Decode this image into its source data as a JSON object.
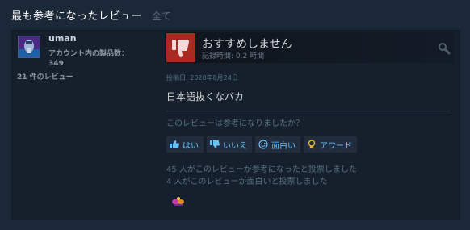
{
  "section": {
    "title": "最も参考になったレビュー",
    "see_all": "全て"
  },
  "author": {
    "name": "uman",
    "products_label": "アカウント内の製品数：",
    "products_count": "349",
    "reviews_count": "21 件のレビュー"
  },
  "review": {
    "verdict": "おすすめしません",
    "playtime": "記録時間: 0.2 時間",
    "posted": "投稿日: 2020年8月24日",
    "body": "日本語抜くなバカ"
  },
  "feedback": {
    "question": "このレビューは参考になりましたか？",
    "buttons": {
      "yes": "はい",
      "no": "いいえ",
      "funny": "面白い",
      "award": "アワード"
    },
    "helpful_stat": "45 人がこのレビューが参考になったと投票しました",
    "funny_stat": "4 人がこのレビューが面白いと投票しました"
  },
  "colors": {
    "background": "#1b2838",
    "panel": "#16202d",
    "thumb_down": "#a82b22",
    "link": "#67c1f5",
    "muted": "#56707f"
  },
  "icons": {
    "thumb_down": "thumbs-down-icon",
    "search": "search-icon",
    "yes": "thumbs-up-icon",
    "no": "thumbs-down-icon",
    "funny": "smiley-icon",
    "award": "award-medal-icon",
    "award_given": "award-badge-icon"
  }
}
